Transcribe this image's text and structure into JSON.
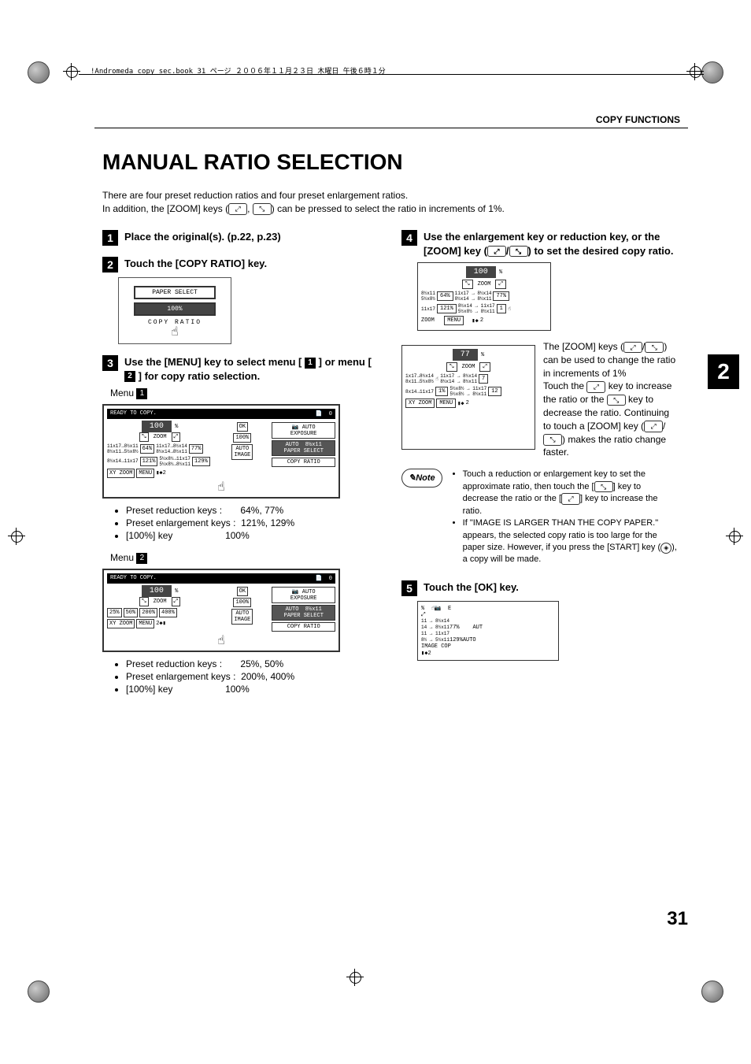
{
  "header": {
    "crop_text": "!Andromeda_copy_sec.book 31 ページ ２００６年１１月２３日 木曜日 午後６時１分",
    "section": "COPY FUNCTIONS"
  },
  "title": "MANUAL RATIO SELECTION",
  "intro_line1": "There are four preset reduction ratios and four preset enlargement ratios.",
  "intro_line2": "In addition, the [ZOOM] keys ( , ) can be pressed to select the ratio in increments of 1%.",
  "step1": {
    "num": "1",
    "title": "Place the original(s). (p.22, p.23)"
  },
  "step2": {
    "num": "2",
    "title": "Touch the [COPY RATIO] key.",
    "panel": {
      "paper_select": "PAPER SELECT",
      "ratio": "100%",
      "copy_ratio": "COPY RATIO"
    }
  },
  "step3": {
    "num": "3",
    "title_a": "Use the [MENU] key to select menu [",
    "title_b": "] or menu [",
    "title_c": "] for copy ratio selection.",
    "menu1_label": "Menu",
    "screen1": {
      "header": "READY TO COPY.",
      "count": "0",
      "ratio": "100",
      "pct": "%",
      "zoom": "ZOOM",
      "rows_left": [
        "11x17→8½x11",
        "8½x11→5½x8½",
        "8½x14→11x17"
      ],
      "r64": "64%",
      "r121": "121%",
      "rows_right": [
        "11x17→8½x14",
        "8½x14→8½x11",
        "5½x8½→11x17",
        "5½x8½→8½x11"
      ],
      "r77": "77%",
      "r129": "129%",
      "ok": "OK",
      "auto_exposure": "AUTO\nEXPOSURE",
      "auto_paper": "AUTO  8½x11\nPAPER SELECT",
      "r100": "100%",
      "auto_image": "AUTO\nIMAGE",
      "copy_ratio": "COPY RATIO",
      "xy_zoom": "XY ZOOM",
      "menu": "MENU",
      "page": "2"
    },
    "bullets1": [
      {
        "k": "Preset reduction keys :",
        "v": "64%, 77%"
      },
      {
        "k": "Preset enlargement keys :",
        "v": "121%, 129%"
      },
      {
        "k": "[100%] key",
        "v": "100%"
      }
    ],
    "menu2_label": "Menu",
    "screen2": {
      "header": "READY TO COPY.",
      "count": "0",
      "ratio": "100",
      "pct": "%",
      "zoom": "ZOOM",
      "r25": "25%",
      "r50": "50%",
      "r200": "200%",
      "r400": "400%",
      "ok": "OK",
      "auto_exposure": "AUTO\nEXPOSURE",
      "auto_paper": "AUTO  8½x11\nPAPER SELECT",
      "r100": "100%",
      "auto_image": "AUTO\nIMAGE",
      "copy_ratio": "COPY RATIO",
      "xy_zoom": "XY ZOOM",
      "menu": "MENU",
      "page": "2"
    },
    "bullets2": [
      {
        "k": "Preset reduction keys :",
        "v": "25%, 50%"
      },
      {
        "k": "Preset enlargement keys :",
        "v": "200%, 400%"
      },
      {
        "k": "[100%] key",
        "v": "100%"
      }
    ]
  },
  "step4": {
    "num": "4",
    "title": "Use the enlargement key or reduction key, or the [ZOOM] key ( / ) to set the desired copy ratio.",
    "panelA": {
      "ratio": "100",
      "pct": "%",
      "zoom": "ZOOM",
      "left1": "8½x11\n5½x8½",
      "r64": "64%",
      "right1": "11x17 → 8½x14\n8½x14 → 8½x11",
      "r77": "77%",
      "left2": "11x17",
      "r121": "121%",
      "right2": "8½x14 → 11x17\n5½x8½ → 8½x11",
      "r1": "1",
      "footer_zoom": "ZOOM",
      "footer_menu": "MENU",
      "footer_page": "2"
    },
    "panelB": {
      "ratio": "77",
      "pct": "%",
      "zoom": "ZOOM",
      "l1": "1x17→8½x14\n8x11→5½x8½",
      "rA": "11x17 → 8½x14\n8½x14 → 8½x11",
      "r7": "7",
      "l2": "8x14→11x17",
      "rB": "5½x8½ → 11x17\n5½x8½ → 8½x11",
      "r12": "12",
      "xy": "XY ZOOM",
      "menu": "MENU",
      "page": "2"
    },
    "desc1": "The [ZOOM] keys ( / ) can be used to change the ratio in increments of 1%",
    "desc2a": "Touch the ",
    "desc2b": " key to increase the ratio or the ",
    "desc2c": " key to decrease the ratio. Continuing to touch a [ZOOM] key ( / ) makes the ratio change faster.",
    "note_label": "Note",
    "note1a": "Touch a reduction or enlargement key to set the approximate ratio, then touch the [",
    "note1b": "] key to decrease the ratio or the [",
    "note1c": "] key to increase the ratio.",
    "note2": "If \"IMAGE IS LARGER THAN THE COPY PAPER.\" appears, the selected copy ratio is too large for the paper size. However, if you press the [START] key ( ), a copy will be made."
  },
  "step5": {
    "num": "5",
    "title": "Touch the [OK] key.",
    "panel": {
      "l1": "11 → 8½x14\n14 → 8½x11",
      "r77": "77%",
      "l2": "11 → 11x17\n8½ → 5½x11",
      "r129": "129%",
      "auto_image": "AUTO\nIMAGE",
      "page": "2",
      "auto": "AUT",
      "exp": "EXP",
      "cop": "COP"
    }
  },
  "side_tab": "2",
  "page_number": "31"
}
